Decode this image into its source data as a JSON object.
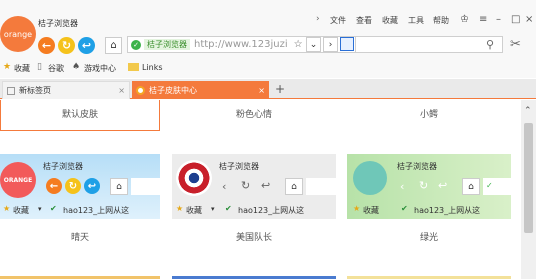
{
  "window": {
    "title": "桔子浏览器",
    "logo_text": "orange",
    "menu": [
      "文件",
      "查看",
      "收藏",
      "工具",
      "帮助"
    ]
  },
  "toolbar": {
    "security_label": "桔子浏览器",
    "url": "http://www.123juzi"
  },
  "bookmarks": [
    "收藏",
    "谷歌",
    "游戏中心",
    "Links"
  ],
  "tabs": [
    {
      "label": "新标签页",
      "close": "×"
    },
    {
      "label": "桔子皮肤中心",
      "close": "×"
    }
  ],
  "new_tab": "+",
  "skins_top_row": [
    "默认皮肤",
    "粉色心情",
    "小鳄"
  ],
  "skins": [
    {
      "label": "晴天",
      "browser": "桔子浏览器",
      "logo": "ORANGE",
      "fav": "收藏",
      "link": "hao123_上网从这"
    },
    {
      "label": "美国队长",
      "browser": "桔子浏览器",
      "fav": "收藏",
      "link": "hao123_上网从这"
    },
    {
      "label": "绿光",
      "browser": "桔子浏览器",
      "fav": "收藏",
      "link": "hao123_上网从这"
    }
  ],
  "colors": {
    "accent": "#f47a3c",
    "nav_orange": "#f57c20",
    "nav_yellow": "#f5c21b",
    "nav_blue": "#1fa0e6",
    "sky": "#a8d8f5",
    "green_skin": "#b7e2a8"
  }
}
